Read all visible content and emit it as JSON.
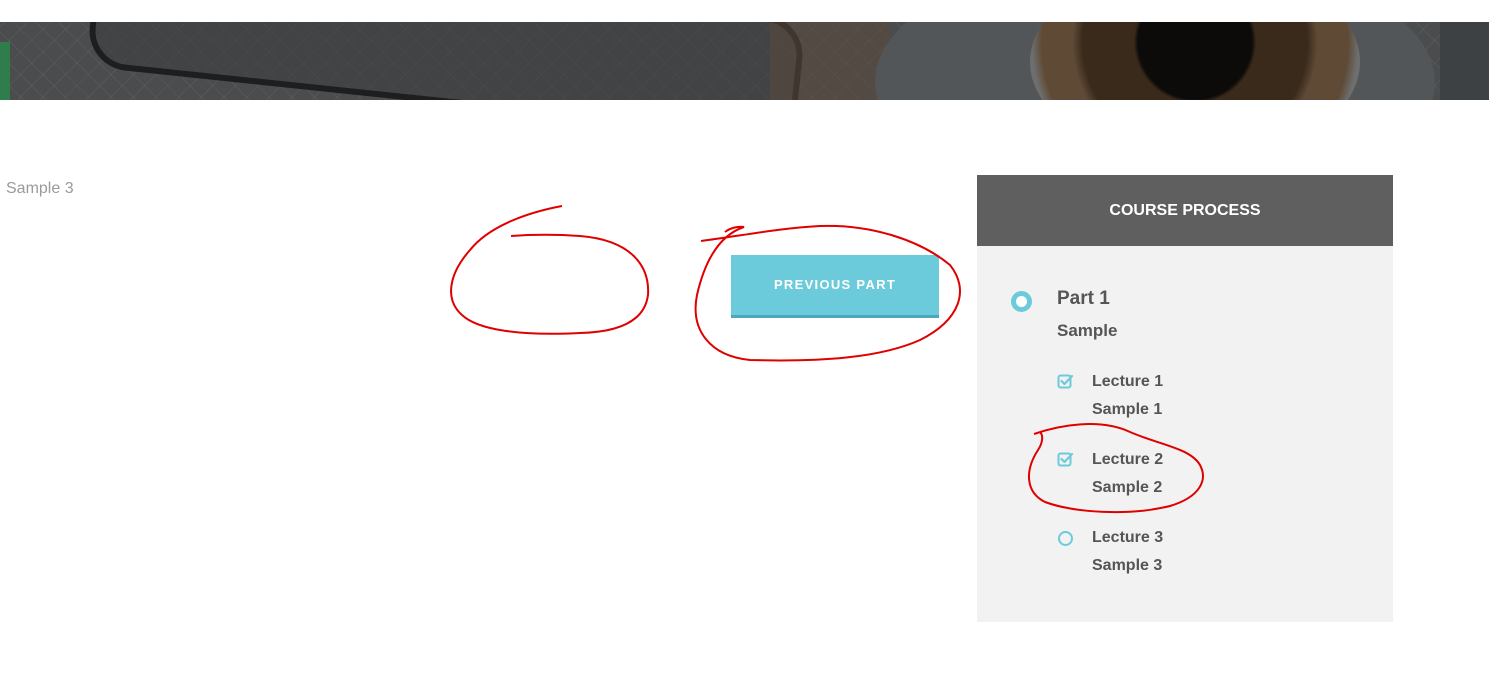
{
  "content": {
    "sample_text": "Sample 3",
    "previous_part_label": "PREVIOUS PART"
  },
  "sidebar": {
    "header": "COURSE PROCESS",
    "part": {
      "title": "Part 1",
      "subtitle": "Sample",
      "status_icon": "circle-icon"
    },
    "lectures": [
      {
        "title": "Lecture 1",
        "subtitle": "Sample 1",
        "status_icon": "checkbox-checked-icon",
        "completed": true
      },
      {
        "title": "Lecture 2",
        "subtitle": "Sample 2",
        "status_icon": "checkbox-checked-icon",
        "completed": true
      },
      {
        "title": "Lecture 3",
        "subtitle": "Sample 3",
        "status_icon": "circle-icon",
        "completed": false
      }
    ]
  },
  "colors": {
    "accent": "#6ccbdb",
    "header_bg": "#5f5f5f",
    "sidebar_bg": "#f2f2f2",
    "annotation": "#e00000"
  }
}
